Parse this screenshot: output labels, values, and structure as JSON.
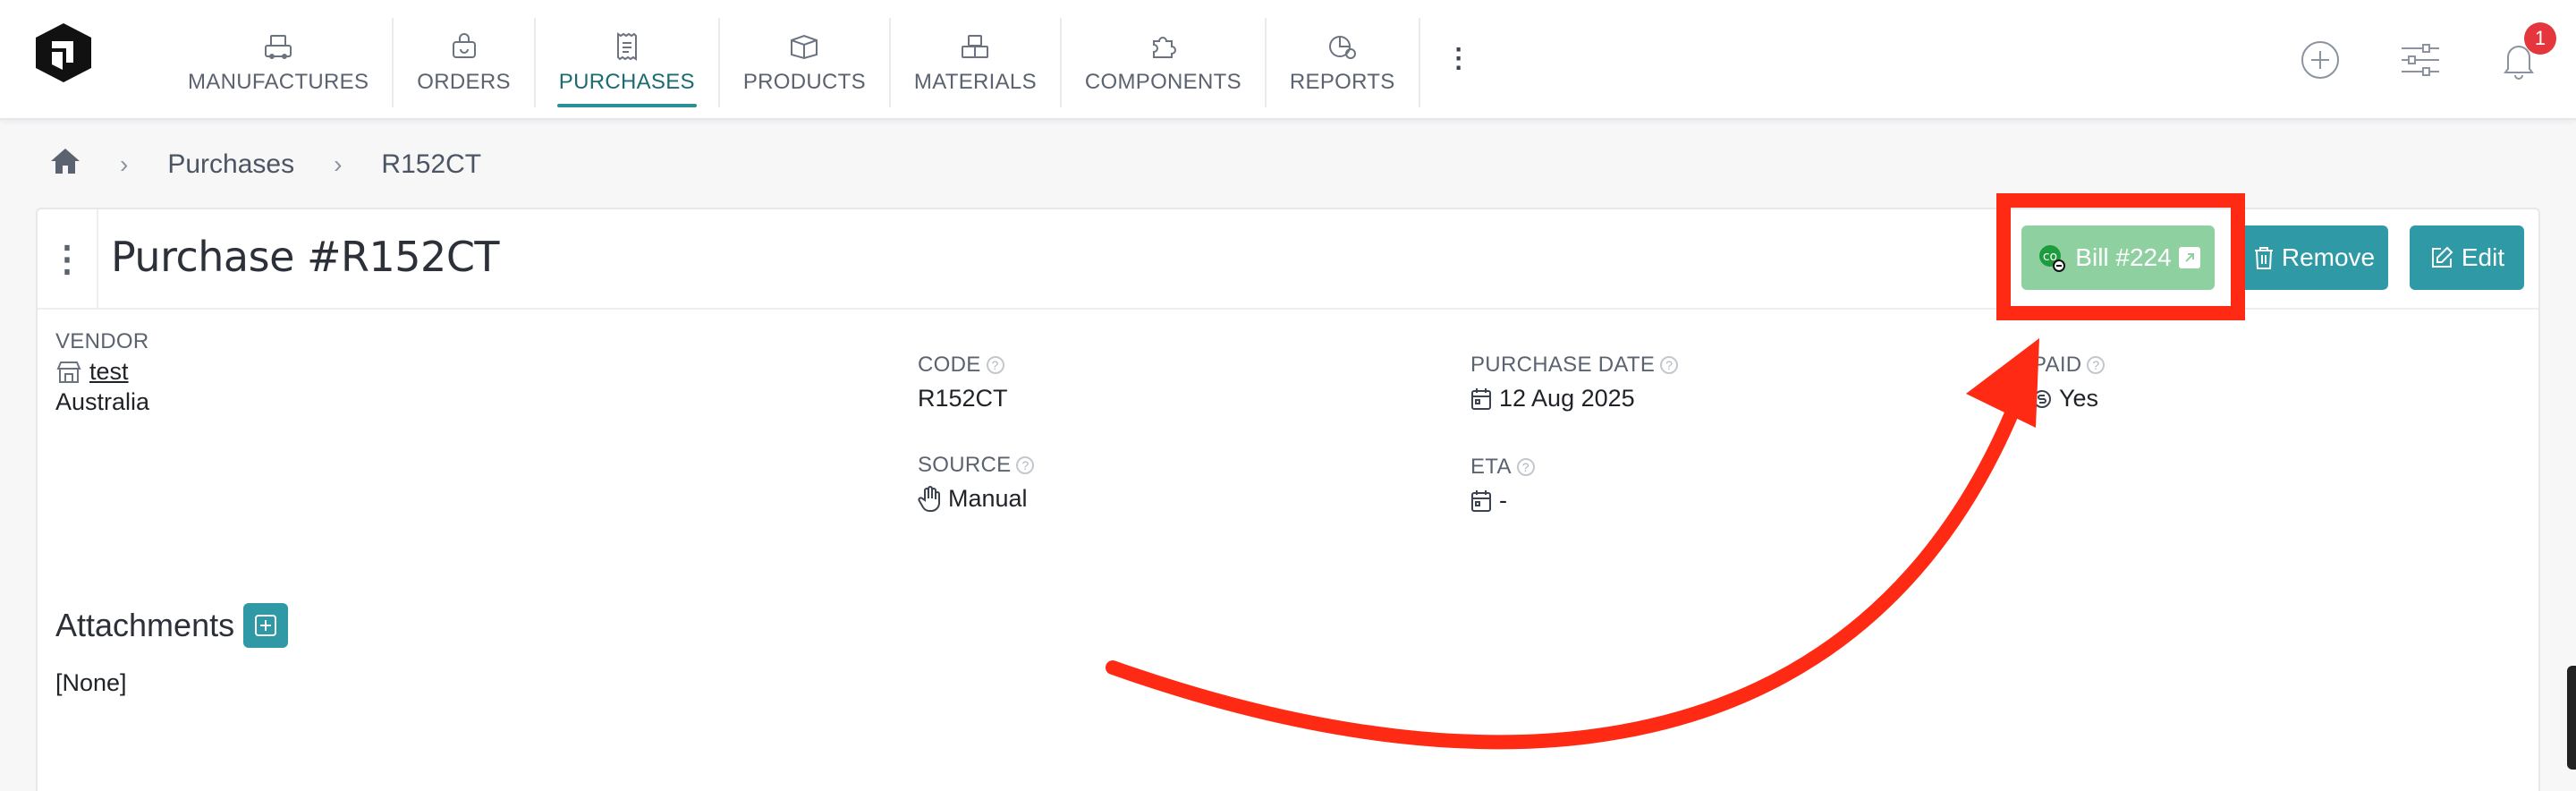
{
  "nav": {
    "items": [
      {
        "label": "MANUFACTURES",
        "icon": "factory-icon"
      },
      {
        "label": "ORDERS",
        "icon": "shopping-bag-icon"
      },
      {
        "label": "PURCHASES",
        "icon": "receipt-icon",
        "active": true
      },
      {
        "label": "PRODUCTS",
        "icon": "box-icon"
      },
      {
        "label": "MATERIALS",
        "icon": "blocks-icon"
      },
      {
        "label": "COMPONENTS",
        "icon": "puzzle-icon"
      },
      {
        "label": "REPORTS",
        "icon": "chart-pie-icon"
      }
    ],
    "more": "⋮"
  },
  "top_actions": {
    "notification_count": "1"
  },
  "breadcrumb": {
    "items": [
      "Purchases",
      "R152CT"
    ]
  },
  "page": {
    "title": "Purchase #R152CT",
    "kebab": "⋮",
    "buttons": {
      "bill": "Bill #224",
      "remove": "Remove",
      "edit": "Edit"
    }
  },
  "fields": {
    "vendor": {
      "label": "VENDOR",
      "name": "test",
      "country": "Australia"
    },
    "code": {
      "label": "CODE",
      "value": "R152CT"
    },
    "purchase_date": {
      "label": "PURCHASE DATE",
      "value": "12 Aug 2025"
    },
    "paid": {
      "label": "PAID",
      "value": "Yes"
    },
    "source": {
      "label": "SOURCE",
      "value": "Manual"
    },
    "eta": {
      "label": "ETA",
      "value": "-"
    }
  },
  "attachments": {
    "title": "Attachments",
    "empty": "[None]"
  },
  "colors": {
    "accent": "#2f9aa6",
    "bill_button": "#8fd0a0",
    "annotation": "#ff2a14",
    "badge": "#e5363d"
  }
}
